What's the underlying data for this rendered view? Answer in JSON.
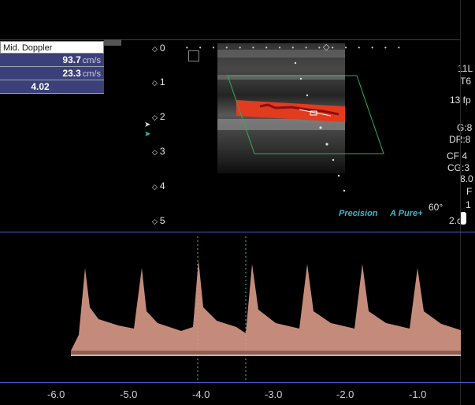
{
  "measurements": {
    "title": "Mid. Doppler",
    "rows": [
      {
        "value": "93.7",
        "unit": "cm/s"
      },
      {
        "value": "23.3",
        "unit": "cm/s"
      },
      {
        "value": "4.02",
        "unit": ""
      }
    ]
  },
  "depth_scale": [
    "0",
    "1",
    "2",
    "3",
    "4",
    "5"
  ],
  "right_panel": [
    "11L",
    "T6",
    "13 fp",
    "G:8",
    "DR:8",
    "CF 4",
    "CG:3",
    "8.0",
    "F",
    "1",
    "2.c"
  ],
  "branding": {
    "precision": "Precision",
    "apure": "Pure+",
    "apure_prefix": "A"
  },
  "steer_angle": "60°",
  "time_axis": [
    "-6.0",
    "-5.0",
    "-4.0",
    "-3.0",
    "-2.0",
    "-1.0"
  ],
  "colors": {
    "flow": "#e23b1e",
    "roi": "#2fae5a",
    "spectrum": "#d99a88",
    "axis": "#3b62c9",
    "cursor": "#2fbfb0"
  }
}
